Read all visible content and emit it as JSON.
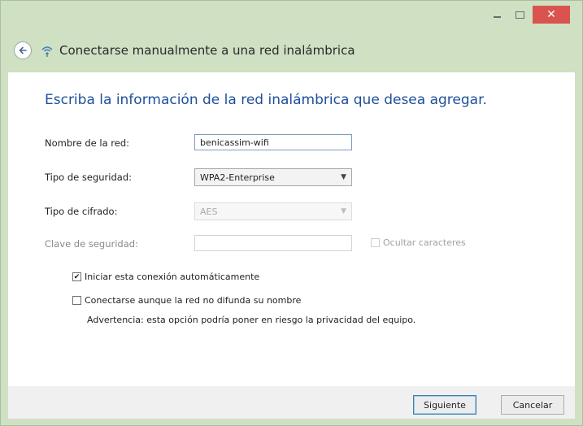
{
  "window": {
    "title": "Conectarse manualmente a una red inalámbrica",
    "close_glyph": "✕"
  },
  "content": {
    "heading": "Escriba la información de la red inalámbrica que desea agregar."
  },
  "form": {
    "network_name": {
      "label": "Nombre de la red:",
      "value": "benicassim-wifi"
    },
    "security_type": {
      "label": "Tipo de seguridad:",
      "value": "WPA2-Enterprise"
    },
    "encryption_type": {
      "label": "Tipo de cifrado:",
      "value": "AES"
    },
    "security_key": {
      "label": "Clave de seguridad:",
      "value": "",
      "hide_chars_label": "Ocultar caracteres"
    },
    "auto_connect": {
      "label": "Iniciar esta conexión automáticamente",
      "checked": true
    },
    "connect_hidden": {
      "label": "Conectarse aunque la red no difunda su nombre",
      "checked": false
    },
    "warning": "Advertencia: esta opción podría poner en riesgo la privacidad del equipo."
  },
  "buttons": {
    "next": "Siguiente",
    "cancel": "Cancelar"
  },
  "icons": {
    "back": "back-arrow-icon",
    "network": "wireless-network-icon",
    "check": "✔",
    "dropdown": "▼"
  },
  "colors": {
    "window_frame": "#cfe0c3",
    "heading": "#1e4f9a",
    "close_button": "#d9534f"
  }
}
